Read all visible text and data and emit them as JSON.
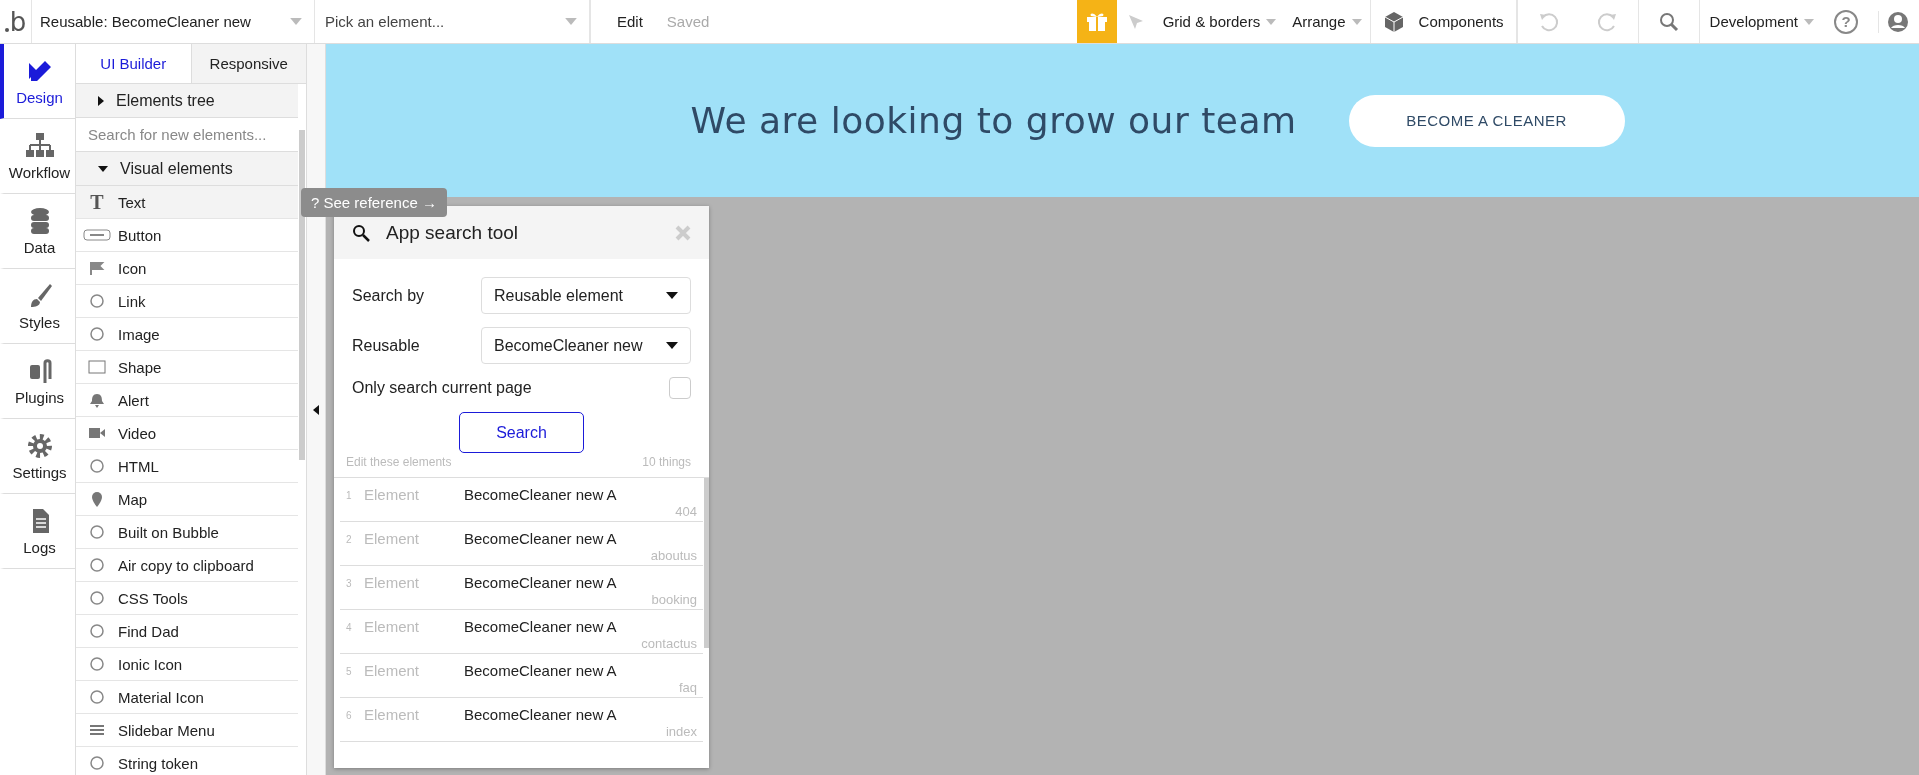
{
  "topbar": {
    "logo": "b",
    "help": "?",
    "reusable_dropdown": "Reusable: BecomeCleaner new",
    "element_picker": {
      "placeholder": "Pick an element..."
    },
    "edit": "Edit",
    "save_status": "Saved",
    "grid_menu": "Grid & borders",
    "arrange_menu": "Arrange",
    "components": "Components",
    "environment": "Development"
  },
  "rail": [
    {
      "label": "Design",
      "selected": true
    },
    {
      "label": "Workflow",
      "selected": false
    },
    {
      "label": "Data",
      "selected": false
    },
    {
      "label": "Styles",
      "selected": false
    },
    {
      "label": "Plugins",
      "selected": false
    },
    {
      "label": "Settings",
      "selected": false
    },
    {
      "label": "Logs",
      "selected": false
    }
  ],
  "panel_tabs": [
    {
      "label": "UI Builder",
      "selected": true
    },
    {
      "label": "Responsive",
      "selected": false
    }
  ],
  "elements_tree": {
    "label": "Elements tree",
    "expanded": false
  },
  "element_search": {
    "placeholder": "Search for new elements..."
  },
  "visual_elements": {
    "label": "Visual elements",
    "expanded": true
  },
  "elements": [
    {
      "label": "Text",
      "glyph": "T",
      "selected": true
    },
    {
      "label": "Button",
      "selected": false
    },
    {
      "label": "Icon",
      "selected": false
    },
    {
      "label": "Link",
      "selected": false
    },
    {
      "label": "Image",
      "selected": false
    },
    {
      "label": "Shape",
      "selected": false
    },
    {
      "label": "Alert",
      "selected": false
    },
    {
      "label": "Video",
      "selected": false
    },
    {
      "label": "HTML",
      "selected": false
    },
    {
      "label": "Map",
      "selected": false
    },
    {
      "label": "Built on Bubble",
      "selected": false
    },
    {
      "label": "Air copy to clipboard",
      "selected": false
    },
    {
      "label": "CSS Tools",
      "selected": false
    },
    {
      "label": "Find Dad",
      "selected": false
    },
    {
      "label": "Ionic Icon",
      "selected": false
    },
    {
      "label": "Material Icon",
      "selected": false
    },
    {
      "label": "Slidebar Menu",
      "selected": false
    },
    {
      "label": "String token",
      "selected": false
    }
  ],
  "tooltip": {
    "icon": "?",
    "text": "See reference →"
  },
  "canvas": {
    "heading": "We are looking to grow our team",
    "button": "BECOME A CLEANER"
  },
  "search_tool": {
    "title": "App search tool",
    "search_by": {
      "label": "Search by",
      "value": "Reusable element"
    },
    "reusable": {
      "label": "Reusable",
      "value": "BecomeCleaner new"
    },
    "only_current_page": {
      "label": "Only search current page",
      "checked": false
    },
    "search_button": "Search",
    "results_label": "Edit these elements",
    "results_count": "10 things",
    "results": [
      {
        "number": "1",
        "type": "Element",
        "name": "BecomeCleaner new A",
        "page": "404"
      },
      {
        "number": "2",
        "type": "Element",
        "name": "BecomeCleaner new A",
        "page": "aboutus"
      },
      {
        "number": "3",
        "type": "Element",
        "name": "BecomeCleaner new A",
        "page": "booking"
      },
      {
        "number": "4",
        "type": "Element",
        "name": "BecomeCleaner new A",
        "page": "contactus"
      },
      {
        "number": "5",
        "type": "Element",
        "name": "BecomeCleaner new A",
        "page": "faq"
      },
      {
        "number": "6",
        "type": "Element",
        "name": "BecomeCleaner new A",
        "page": "index"
      }
    ]
  }
}
